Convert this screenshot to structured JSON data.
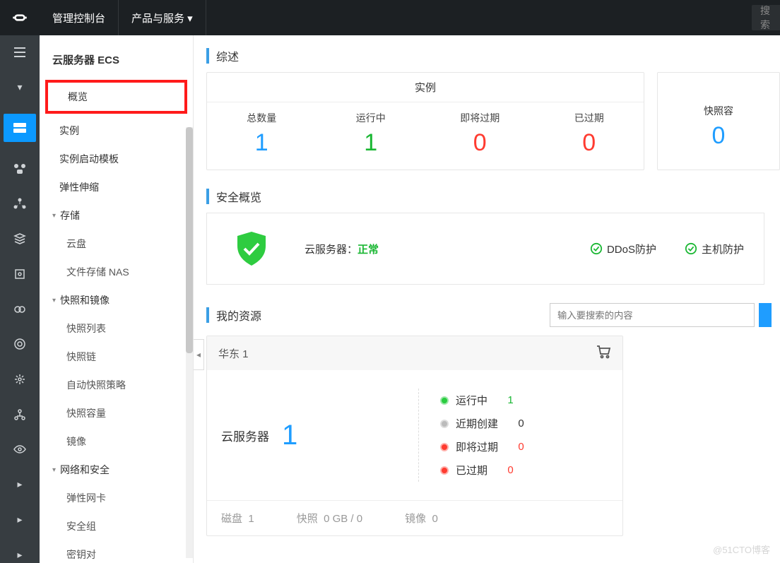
{
  "top": {
    "console": "管理控制台",
    "products": "产品与服务 ▾",
    "search": "搜索"
  },
  "sidebar": {
    "title": "云服务器 ECS",
    "items": [
      "概览",
      "实例",
      "实例启动模板",
      "弹性伸缩"
    ],
    "g_storage": "存储",
    "storage_items": [
      "云盘",
      "文件存储 NAS"
    ],
    "g_snapshot": "快照和镜像",
    "snapshot_items": [
      "快照列表",
      "快照链",
      "自动快照策略",
      "快照容量",
      "镜像"
    ],
    "g_network": "网络和安全",
    "network_items": [
      "弹性网卡",
      "安全组",
      "密钥对"
    ]
  },
  "sections": {
    "summary": "综述",
    "security": "安全概览",
    "myres": "我的资源"
  },
  "instance_card": {
    "head": "实例",
    "stats": [
      {
        "label": "总数量",
        "value": "1",
        "color": "blue"
      },
      {
        "label": "运行中",
        "value": "1",
        "color": "green"
      },
      {
        "label": "即将过期",
        "value": "0",
        "color": "red"
      },
      {
        "label": "已过期",
        "value": "0",
        "color": "red"
      }
    ]
  },
  "snapshot_card": {
    "label": "快照容",
    "value": "0"
  },
  "security": {
    "server_label": "云服务器：",
    "status": "正常",
    "ddos": "DDoS防护",
    "host": "主机防护"
  },
  "search_ph": "输入要搜索的内容",
  "resource_card": {
    "region": "华东 1",
    "server_label": "云服务器",
    "server_count": "1",
    "statuses": [
      {
        "dot": "g",
        "label": "运行中",
        "value": "1",
        "vclass": "green"
      },
      {
        "dot": "gr",
        "label": "近期创建",
        "value": "0",
        "vclass": ""
      },
      {
        "dot": "r",
        "label": "即将过期",
        "value": "0",
        "vclass": "red"
      },
      {
        "dot": "r",
        "label": "已过期",
        "value": "0",
        "vclass": "red"
      }
    ],
    "footer": [
      {
        "label": "磁盘",
        "value": "1"
      },
      {
        "label": "快照",
        "value": "0 GB / 0"
      },
      {
        "label": "镜像",
        "value": "0"
      }
    ]
  },
  "watermark": "@51CTO博客"
}
